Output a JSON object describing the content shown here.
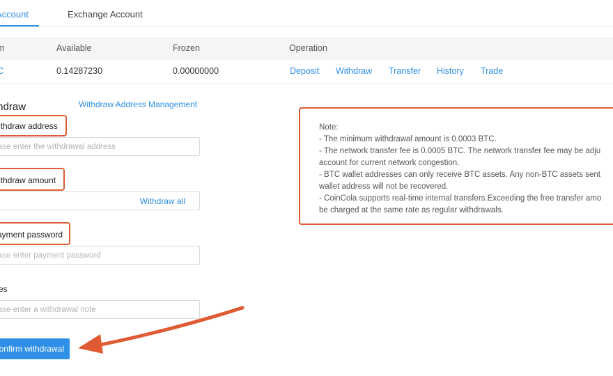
{
  "tabs": [
    {
      "label": "Account"
    },
    {
      "label": "Exchange Account"
    }
  ],
  "table": {
    "headers": [
      "m",
      "Available",
      "Frozen",
      "Operation"
    ],
    "row": {
      "coin": "C",
      "available": "0.14287230",
      "frozen": "0.00000000"
    },
    "operations": [
      "Deposit",
      "Withdraw",
      "Transfer",
      "History",
      "Trade"
    ]
  },
  "form": {
    "title": "thdraw",
    "address_management": "Withdraw Address Management",
    "address_label": "ithdraw address",
    "address_placeholder": "ase enter the withdrawal address",
    "amount_label": "ithdraw amount",
    "withdraw_all": "Withdraw all",
    "password_label": "ayment password",
    "password_placeholder": "ase enter payment password",
    "notes_label": "es",
    "notes_placeholder": "ase enter a withdrawal note",
    "confirm": "onfirm withdrawal"
  },
  "note": {
    "lines": [
      "Note:",
      "- The minimum withdrawal amount is 0.0003 BTC.",
      "- The network transfer fee is 0.0005 BTC. The network transfer fee may be adju",
      "account for current network congestion.",
      "- BTC wallet addresses can only receive BTC assets. Any non-BTC assets sent",
      "wallet address will not be recovered.",
      "- CoinCola supports real-time internal transfers.Exceeding the free transfer amo",
      "be charged at the same rate as regular withdrawals."
    ]
  },
  "colors": {
    "accent": "#2f8fe6",
    "highlight": "#e05a33"
  }
}
